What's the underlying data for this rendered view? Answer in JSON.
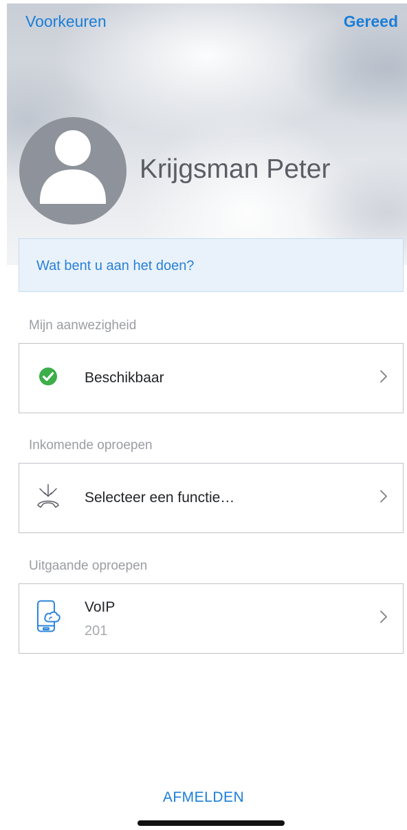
{
  "nav": {
    "left_label": "Voorkeuren",
    "right_label": "Gereed"
  },
  "profile": {
    "name": "Krijgsman Peter",
    "avatar_icon": "person-placeholder-icon"
  },
  "status_input": {
    "placeholder": "Wat bent u aan het doen?"
  },
  "sections": {
    "presence": {
      "label": "Mijn aanwezigheid",
      "row_label": "Beschikbaar",
      "icon": "available-check-icon",
      "icon_color": "#3cae4a"
    },
    "incoming": {
      "label": "Inkomende oproepen",
      "row_label": "Selecteer een functie…",
      "icon": "incoming-call-icon"
    },
    "outgoing": {
      "label": "Uitgaande oproepen",
      "row_label": "VoIP",
      "row_sub": "201",
      "icon": "voip-phone-icon"
    }
  },
  "footer": {
    "logout_label": "AFMELDEN"
  },
  "colors": {
    "accent": "#1a7ed8",
    "status_box_bg": "#e9f2fa"
  }
}
